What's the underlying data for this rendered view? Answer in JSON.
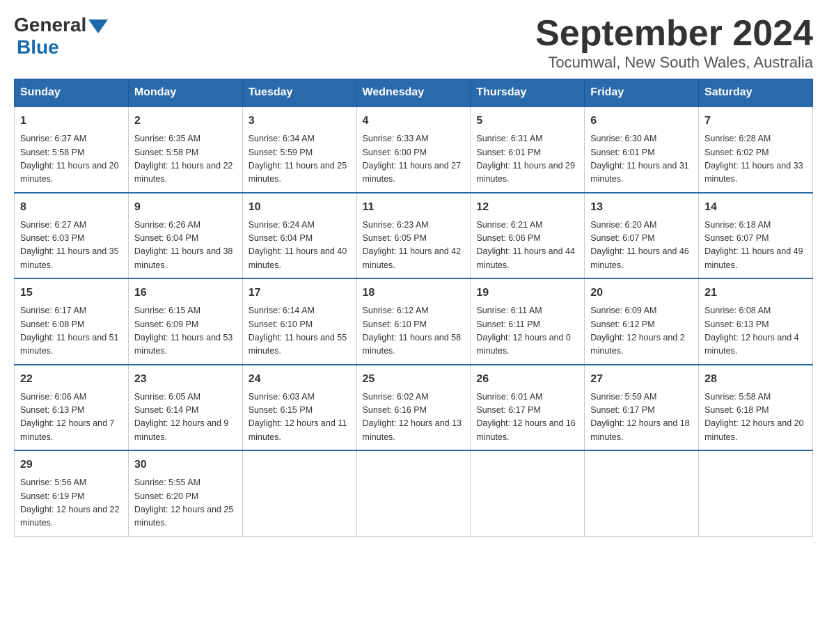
{
  "header": {
    "logo_general": "General",
    "logo_blue": "Blue",
    "title": "September 2024",
    "subtitle": "Tocumwal, New South Wales, Australia"
  },
  "days_of_week": [
    "Sunday",
    "Monday",
    "Tuesday",
    "Wednesday",
    "Thursday",
    "Friday",
    "Saturday"
  ],
  "weeks": [
    [
      {
        "day": "1",
        "sunrise": "Sunrise: 6:37 AM",
        "sunset": "Sunset: 5:58 PM",
        "daylight": "Daylight: 11 hours and 20 minutes."
      },
      {
        "day": "2",
        "sunrise": "Sunrise: 6:35 AM",
        "sunset": "Sunset: 5:58 PM",
        "daylight": "Daylight: 11 hours and 22 minutes."
      },
      {
        "day": "3",
        "sunrise": "Sunrise: 6:34 AM",
        "sunset": "Sunset: 5:59 PM",
        "daylight": "Daylight: 11 hours and 25 minutes."
      },
      {
        "day": "4",
        "sunrise": "Sunrise: 6:33 AM",
        "sunset": "Sunset: 6:00 PM",
        "daylight": "Daylight: 11 hours and 27 minutes."
      },
      {
        "day": "5",
        "sunrise": "Sunrise: 6:31 AM",
        "sunset": "Sunset: 6:01 PM",
        "daylight": "Daylight: 11 hours and 29 minutes."
      },
      {
        "day": "6",
        "sunrise": "Sunrise: 6:30 AM",
        "sunset": "Sunset: 6:01 PM",
        "daylight": "Daylight: 11 hours and 31 minutes."
      },
      {
        "day": "7",
        "sunrise": "Sunrise: 6:28 AM",
        "sunset": "Sunset: 6:02 PM",
        "daylight": "Daylight: 11 hours and 33 minutes."
      }
    ],
    [
      {
        "day": "8",
        "sunrise": "Sunrise: 6:27 AM",
        "sunset": "Sunset: 6:03 PM",
        "daylight": "Daylight: 11 hours and 35 minutes."
      },
      {
        "day": "9",
        "sunrise": "Sunrise: 6:26 AM",
        "sunset": "Sunset: 6:04 PM",
        "daylight": "Daylight: 11 hours and 38 minutes."
      },
      {
        "day": "10",
        "sunrise": "Sunrise: 6:24 AM",
        "sunset": "Sunset: 6:04 PM",
        "daylight": "Daylight: 11 hours and 40 minutes."
      },
      {
        "day": "11",
        "sunrise": "Sunrise: 6:23 AM",
        "sunset": "Sunset: 6:05 PM",
        "daylight": "Daylight: 11 hours and 42 minutes."
      },
      {
        "day": "12",
        "sunrise": "Sunrise: 6:21 AM",
        "sunset": "Sunset: 6:06 PM",
        "daylight": "Daylight: 11 hours and 44 minutes."
      },
      {
        "day": "13",
        "sunrise": "Sunrise: 6:20 AM",
        "sunset": "Sunset: 6:07 PM",
        "daylight": "Daylight: 11 hours and 46 minutes."
      },
      {
        "day": "14",
        "sunrise": "Sunrise: 6:18 AM",
        "sunset": "Sunset: 6:07 PM",
        "daylight": "Daylight: 11 hours and 49 minutes."
      }
    ],
    [
      {
        "day": "15",
        "sunrise": "Sunrise: 6:17 AM",
        "sunset": "Sunset: 6:08 PM",
        "daylight": "Daylight: 11 hours and 51 minutes."
      },
      {
        "day": "16",
        "sunrise": "Sunrise: 6:15 AM",
        "sunset": "Sunset: 6:09 PM",
        "daylight": "Daylight: 11 hours and 53 minutes."
      },
      {
        "day": "17",
        "sunrise": "Sunrise: 6:14 AM",
        "sunset": "Sunset: 6:10 PM",
        "daylight": "Daylight: 11 hours and 55 minutes."
      },
      {
        "day": "18",
        "sunrise": "Sunrise: 6:12 AM",
        "sunset": "Sunset: 6:10 PM",
        "daylight": "Daylight: 11 hours and 58 minutes."
      },
      {
        "day": "19",
        "sunrise": "Sunrise: 6:11 AM",
        "sunset": "Sunset: 6:11 PM",
        "daylight": "Daylight: 12 hours and 0 minutes."
      },
      {
        "day": "20",
        "sunrise": "Sunrise: 6:09 AM",
        "sunset": "Sunset: 6:12 PM",
        "daylight": "Daylight: 12 hours and 2 minutes."
      },
      {
        "day": "21",
        "sunrise": "Sunrise: 6:08 AM",
        "sunset": "Sunset: 6:13 PM",
        "daylight": "Daylight: 12 hours and 4 minutes."
      }
    ],
    [
      {
        "day": "22",
        "sunrise": "Sunrise: 6:06 AM",
        "sunset": "Sunset: 6:13 PM",
        "daylight": "Daylight: 12 hours and 7 minutes."
      },
      {
        "day": "23",
        "sunrise": "Sunrise: 6:05 AM",
        "sunset": "Sunset: 6:14 PM",
        "daylight": "Daylight: 12 hours and 9 minutes."
      },
      {
        "day": "24",
        "sunrise": "Sunrise: 6:03 AM",
        "sunset": "Sunset: 6:15 PM",
        "daylight": "Daylight: 12 hours and 11 minutes."
      },
      {
        "day": "25",
        "sunrise": "Sunrise: 6:02 AM",
        "sunset": "Sunset: 6:16 PM",
        "daylight": "Daylight: 12 hours and 13 minutes."
      },
      {
        "day": "26",
        "sunrise": "Sunrise: 6:01 AM",
        "sunset": "Sunset: 6:17 PM",
        "daylight": "Daylight: 12 hours and 16 minutes."
      },
      {
        "day": "27",
        "sunrise": "Sunrise: 5:59 AM",
        "sunset": "Sunset: 6:17 PM",
        "daylight": "Daylight: 12 hours and 18 minutes."
      },
      {
        "day": "28",
        "sunrise": "Sunrise: 5:58 AM",
        "sunset": "Sunset: 6:18 PM",
        "daylight": "Daylight: 12 hours and 20 minutes."
      }
    ],
    [
      {
        "day": "29",
        "sunrise": "Sunrise: 5:56 AM",
        "sunset": "Sunset: 6:19 PM",
        "daylight": "Daylight: 12 hours and 22 minutes."
      },
      {
        "day": "30",
        "sunrise": "Sunrise: 5:55 AM",
        "sunset": "Sunset: 6:20 PM",
        "daylight": "Daylight: 12 hours and 25 minutes."
      },
      null,
      null,
      null,
      null,
      null
    ]
  ]
}
